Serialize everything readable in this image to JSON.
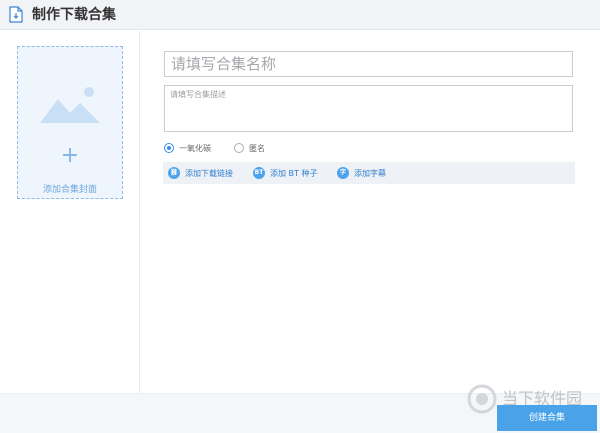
{
  "header": {
    "title": "制作下载合集",
    "icon": "document-download-icon"
  },
  "cover": {
    "add_label": "添加合集封面",
    "icon": "image-placeholder-icon",
    "plus": "+"
  },
  "form": {
    "name_placeholder": "请填写合集名称",
    "name_value": "",
    "desc_placeholder": "请填写合集描述",
    "desc_value": ""
  },
  "visibility": {
    "options": [
      {
        "label": "一氧化碳",
        "checked": true
      },
      {
        "label": "匿名",
        "checked": false
      }
    ]
  },
  "toolbar": {
    "items": [
      {
        "label": "添加下载链接",
        "icon": "link-icon",
        "glyph": "⛓"
      },
      {
        "label": "添加 BT 种子",
        "icon": "bt-icon",
        "glyph": "BT"
      },
      {
        "label": "添加字幕",
        "icon": "subtitle-icon",
        "glyph": "字"
      }
    ]
  },
  "watermark": {
    "text": "当下软件园"
  },
  "footer": {
    "create_label": "创建合集"
  },
  "colors": {
    "accent": "#4aa3e8",
    "link": "#2f7fcf",
    "cover_bg": "#eef5fd"
  }
}
